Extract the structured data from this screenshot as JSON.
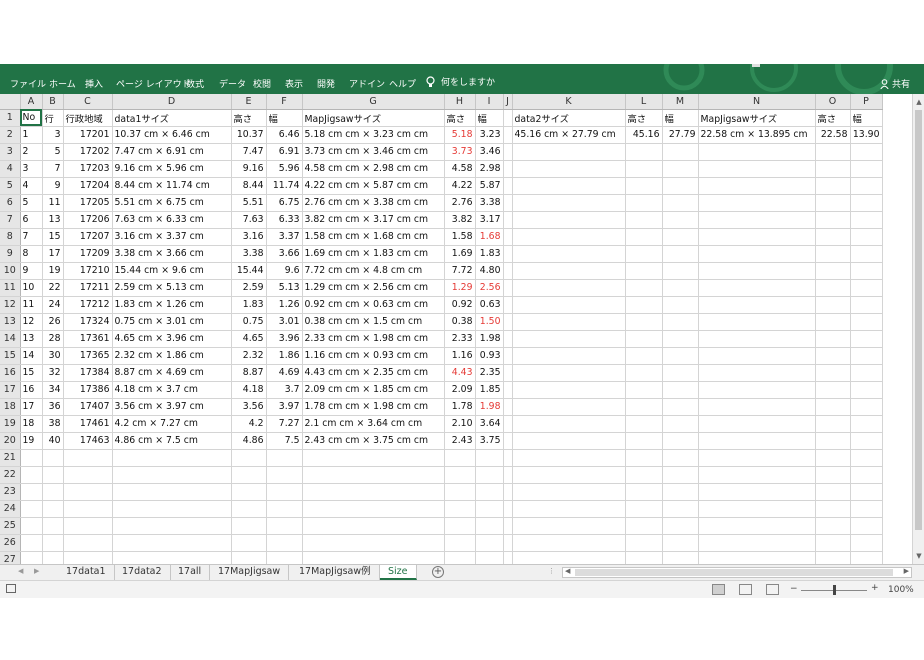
{
  "ribbon": {
    "tabs": [
      "ファイル",
      "ホーム",
      "挿入",
      "ページ レイアウト",
      "数式",
      "データ",
      "校閲",
      "表示",
      "開発",
      "アドイン",
      "ヘルプ"
    ],
    "tell_me": "何をしますか",
    "share": "共有",
    "color": "#217346"
  },
  "grid": {
    "columns": [
      "A",
      "B",
      "C",
      "D",
      "E",
      "F",
      "G",
      "H",
      "I",
      "J",
      "K",
      "L",
      "M",
      "N",
      "O",
      "P"
    ],
    "row_numbers": [
      "1",
      "2",
      "3",
      "4",
      "5",
      "6",
      "7",
      "8",
      "9",
      "10",
      "11",
      "12",
      "13",
      "14",
      "15",
      "16",
      "17",
      "18",
      "19",
      "20",
      "21",
      "22",
      "23",
      "24",
      "25",
      "26",
      "27"
    ],
    "header_row": [
      "No",
      "行",
      "行政地域",
      "data1サイズ",
      "高さ",
      "幅",
      "MapJigsawサイズ",
      "高さ",
      "幅",
      "",
      "data2サイズ",
      "高さ",
      "幅",
      "MapJigsawサイズ",
      "高さ",
      "幅"
    ],
    "rows": [
      [
        "1",
        "3",
        "17201",
        "10.37 cm × 6.46 cm",
        "10.37",
        "6.46",
        "5.18 cm cm × 3.23 cm cm",
        "5.18",
        "3.23",
        "",
        "45.16 cm × 27.79 cm",
        "45.16",
        "27.79",
        "22.58 cm × 13.895 cm",
        "22.58",
        "13.90"
      ],
      [
        "2",
        "5",
        "17202",
        "7.47 cm × 6.91 cm",
        "7.47",
        "6.91",
        "3.73 cm cm × 3.46 cm cm",
        "3.73",
        "3.46",
        "",
        "",
        "",
        "",
        "",
        "",
        ""
      ],
      [
        "3",
        "7",
        "17203",
        "9.16 cm × 5.96 cm",
        "9.16",
        "5.96",
        "4.58 cm cm × 2.98 cm cm",
        "4.58",
        "2.98",
        "",
        "",
        "",
        "",
        "",
        "",
        ""
      ],
      [
        "4",
        "9",
        "17204",
        "8.44 cm × 11.74 cm",
        "8.44",
        "11.74",
        "4.22 cm cm × 5.87 cm cm",
        "4.22",
        "5.87",
        "",
        "",
        "",
        "",
        "",
        "",
        ""
      ],
      [
        "5",
        "11",
        "17205",
        "5.51 cm × 6.75 cm",
        "5.51",
        "6.75",
        "2.76 cm cm × 3.38 cm cm",
        "2.76",
        "3.38",
        "",
        "",
        "",
        "",
        "",
        "",
        ""
      ],
      [
        "6",
        "13",
        "17206",
        "7.63 cm × 6.33 cm",
        "7.63",
        "6.33",
        "3.82 cm cm × 3.17 cm cm",
        "3.82",
        "3.17",
        "",
        "",
        "",
        "",
        "",
        "",
        ""
      ],
      [
        "7",
        "15",
        "17207",
        "3.16 cm × 3.37 cm",
        "3.16",
        "3.37",
        "1.58 cm cm × 1.68 cm cm",
        "1.58",
        "1.68",
        "",
        "",
        "",
        "",
        "",
        "",
        ""
      ],
      [
        "8",
        "17",
        "17209",
        "3.38 cm × 3.66 cm",
        "3.38",
        "3.66",
        "1.69 cm cm × 1.83 cm cm",
        "1.69",
        "1.83",
        "",
        "",
        "",
        "",
        "",
        "",
        ""
      ],
      [
        "9",
        "19",
        "17210",
        "15.44 cm × 9.6 cm",
        "15.44",
        "9.6",
        "7.72 cm cm × 4.8 cm cm",
        "7.72",
        "4.80",
        "",
        "",
        "",
        "",
        "",
        "",
        ""
      ],
      [
        "10",
        "22",
        "17211",
        "2.59 cm × 5.13 cm",
        "2.59",
        "5.13",
        "1.29 cm cm × 2.56 cm cm",
        "1.29",
        "2.56",
        "",
        "",
        "",
        "",
        "",
        "",
        ""
      ],
      [
        "11",
        "24",
        "17212",
        "1.83 cm × 1.26 cm",
        "1.83",
        "1.26",
        "0.92 cm cm × 0.63 cm cm",
        "0.92",
        "0.63",
        "",
        "",
        "",
        "",
        "",
        "",
        ""
      ],
      [
        "12",
        "26",
        "17324",
        "0.75 cm × 3.01 cm",
        "0.75",
        "3.01",
        "0.38 cm cm × 1.5 cm cm",
        "0.38",
        "1.50",
        "",
        "",
        "",
        "",
        "",
        "",
        ""
      ],
      [
        "13",
        "28",
        "17361",
        "4.65 cm × 3.96 cm",
        "4.65",
        "3.96",
        "2.33 cm cm × 1.98 cm cm",
        "2.33",
        "1.98",
        "",
        "",
        "",
        "",
        "",
        "",
        ""
      ],
      [
        "14",
        "30",
        "17365",
        "2.32 cm × 1.86 cm",
        "2.32",
        "1.86",
        "1.16 cm cm × 0.93 cm cm",
        "1.16",
        "0.93",
        "",
        "",
        "",
        "",
        "",
        "",
        ""
      ],
      [
        "15",
        "32",
        "17384",
        "8.87 cm × 4.69 cm",
        "8.87",
        "4.69",
        "4.43 cm cm × 2.35 cm cm",
        "4.43",
        "2.35",
        "",
        "",
        "",
        "",
        "",
        "",
        ""
      ],
      [
        "16",
        "34",
        "17386",
        "4.18 cm × 3.7 cm",
        "4.18",
        "3.7",
        "2.09 cm cm × 1.85 cm cm",
        "2.09",
        "1.85",
        "",
        "",
        "",
        "",
        "",
        "",
        ""
      ],
      [
        "17",
        "36",
        "17407",
        "3.56 cm × 3.97 cm",
        "3.56",
        "3.97",
        "1.78 cm cm × 1.98 cm cm",
        "1.78",
        "1.98",
        "",
        "",
        "",
        "",
        "",
        "",
        ""
      ],
      [
        "18",
        "38",
        "17461",
        "4.2 cm × 7.27 cm",
        "4.2",
        "7.27",
        "2.1 cm cm × 3.64 cm cm",
        "2.10",
        "3.64",
        "",
        "",
        "",
        "",
        "",
        "",
        ""
      ],
      [
        "19",
        "40",
        "17463",
        "4.86 cm × 7.5 cm",
        "4.86",
        "7.5",
        "2.43 cm cm × 3.75 cm cm",
        "2.43",
        "3.75",
        "",
        "",
        "",
        "",
        "",
        "",
        ""
      ]
    ],
    "red_cells": [
      [
        2,
        7
      ],
      [
        3,
        7
      ],
      [
        8,
        8
      ],
      [
        11,
        7
      ],
      [
        11,
        8
      ],
      [
        13,
        8
      ],
      [
        16,
        7
      ],
      [
        18,
        8
      ]
    ],
    "red_color": "#e53935"
  },
  "sheet_tabs": [
    "17data1",
    "17data2",
    "17all",
    "17MapJigsaw",
    "17MapJigsaw例",
    "Size"
  ],
  "active_sheet": "Size",
  "status": {
    "zoom": "100%"
  }
}
